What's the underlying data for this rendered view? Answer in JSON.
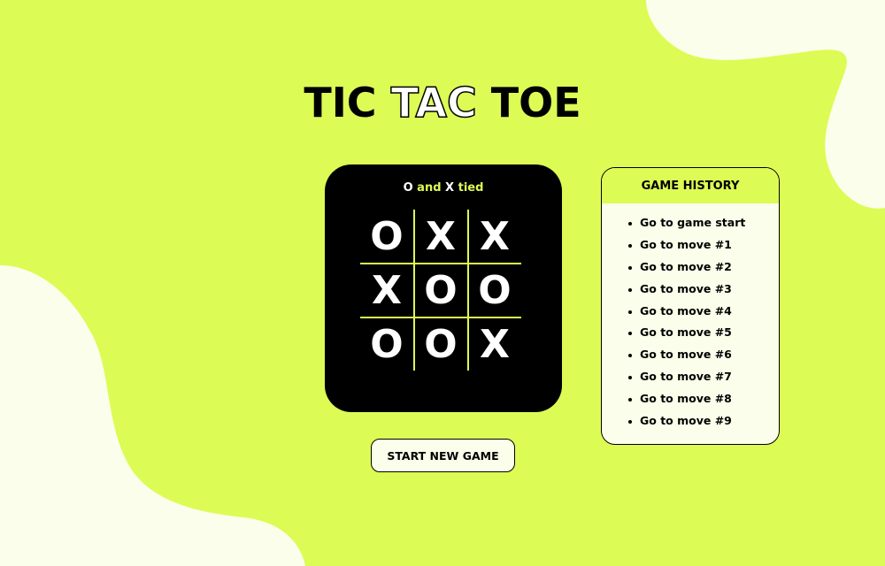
{
  "colors": {
    "background": "#DDFB55",
    "blob": "#FBFEEA",
    "board": "#000000",
    "accent": "#DDFB55",
    "mark": "#FFFFFF"
  },
  "title": {
    "word1": "TIC",
    "word2": "TAC",
    "word3": "TOE"
  },
  "status": {
    "player1": "O",
    "connector": "and",
    "player2": "X",
    "result": "tied"
  },
  "board": {
    "cells": [
      "O",
      "X",
      "X",
      "X",
      "O",
      "O",
      "O",
      "O",
      "X"
    ]
  },
  "new_game_button": {
    "label": "START NEW GAME"
  },
  "history": {
    "heading": "GAME HISTORY",
    "items": [
      "Go to game start",
      "Go to move #1",
      "Go to move #2",
      "Go to move #3",
      "Go to move #4",
      "Go to move #5",
      "Go to move #6",
      "Go to move #7",
      "Go to move #8",
      "Go to move #9"
    ]
  }
}
